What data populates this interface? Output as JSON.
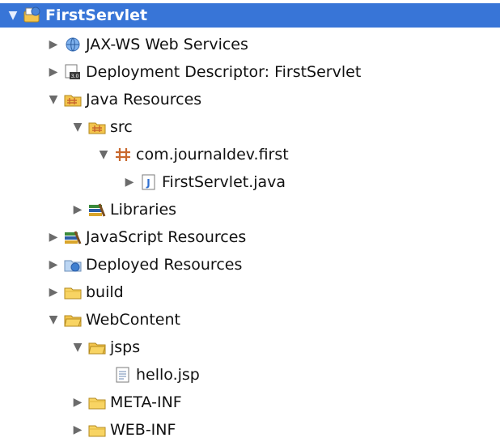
{
  "tree": {
    "root": {
      "label": "FirstServlet",
      "icon": "web-project-icon",
      "expanded": true,
      "selected": true
    },
    "items": [
      {
        "label": "JAX-WS Web Services",
        "icon": "web-services-icon",
        "expanded": false
      },
      {
        "label": "Deployment Descriptor: FirstServlet",
        "icon": "deployment-descriptor-icon",
        "expanded": false
      },
      {
        "label": "Java Resources",
        "icon": "java-resources-icon",
        "expanded": true
      },
      {
        "label": "src",
        "icon": "source-folder-icon",
        "expanded": true
      },
      {
        "label": "com.journaldev.first",
        "icon": "package-icon",
        "expanded": true
      },
      {
        "label": "FirstServlet.java",
        "icon": "java-file-icon",
        "expanded": false
      },
      {
        "label": "Libraries",
        "icon": "libraries-icon",
        "expanded": false
      },
      {
        "label": "JavaScript Resources",
        "icon": "libraries-icon",
        "expanded": false
      },
      {
        "label": "Deployed Resources",
        "icon": "deployed-resources-icon",
        "expanded": false
      },
      {
        "label": "build",
        "icon": "folder-icon",
        "expanded": false
      },
      {
        "label": "WebContent",
        "icon": "folder-open-icon",
        "expanded": true
      },
      {
        "label": "jsps",
        "icon": "folder-open-icon",
        "expanded": true
      },
      {
        "label": "hello.jsp",
        "icon": "jsp-file-icon",
        "expanded": null
      },
      {
        "label": "META-INF",
        "icon": "folder-icon",
        "expanded": false
      },
      {
        "label": "WEB-INF",
        "icon": "folder-icon",
        "expanded": false
      }
    ]
  },
  "colors": {
    "selection": "#3875d7",
    "folder": "#f3c44c",
    "package": "#c9692e",
    "java": "#2f6fd1"
  }
}
